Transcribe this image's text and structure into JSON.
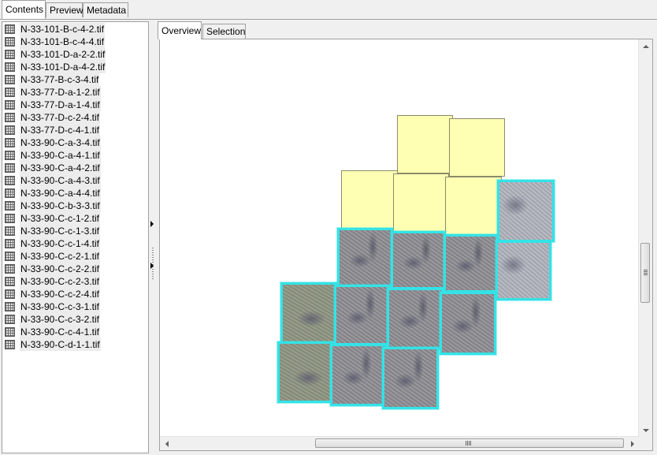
{
  "top_tabs": [
    "Contents",
    "Preview",
    "Metadata"
  ],
  "files": [
    "N-33-101-B-c-4-2.tif",
    "N-33-101-B-c-4-4.tif",
    "N-33-101-D-a-2-2.tif",
    "N-33-101-D-a-4-2.tif",
    "N-33-77-B-c-3-4.tif",
    "N-33-77-D-a-1-2.tif",
    "N-33-77-D-a-1-4.tif",
    "N-33-77-D-c-2-4.tif",
    "N-33-77-D-c-4-1.tif",
    "N-33-90-C-a-3-4.tif",
    "N-33-90-C-a-4-1.tif",
    "N-33-90-C-a-4-2.tif",
    "N-33-90-C-a-4-3.tif",
    "N-33-90-C-a-4-4.tif",
    "N-33-90-C-b-3-3.tif",
    "N-33-90-C-c-1-2.tif",
    "N-33-90-C-c-1-3.tif",
    "N-33-90-C-c-1-4.tif",
    "N-33-90-C-c-2-1.tif",
    "N-33-90-C-c-2-2.tif",
    "N-33-90-C-c-2-3.tif",
    "N-33-90-C-c-2-4.tif",
    "N-33-90-C-c-3-1.tif",
    "N-33-90-C-c-3-2.tif",
    "N-33-90-C-c-4-1.tif",
    "N-33-90-C-d-1-1.tif"
  ],
  "file_icon": "raster-dataset-icon",
  "sub_tabs": [
    "Overview",
    "Selection"
  ],
  "colors": {
    "footprint_fill": "#ffffb3",
    "selection_outline": "#34e2e6"
  }
}
